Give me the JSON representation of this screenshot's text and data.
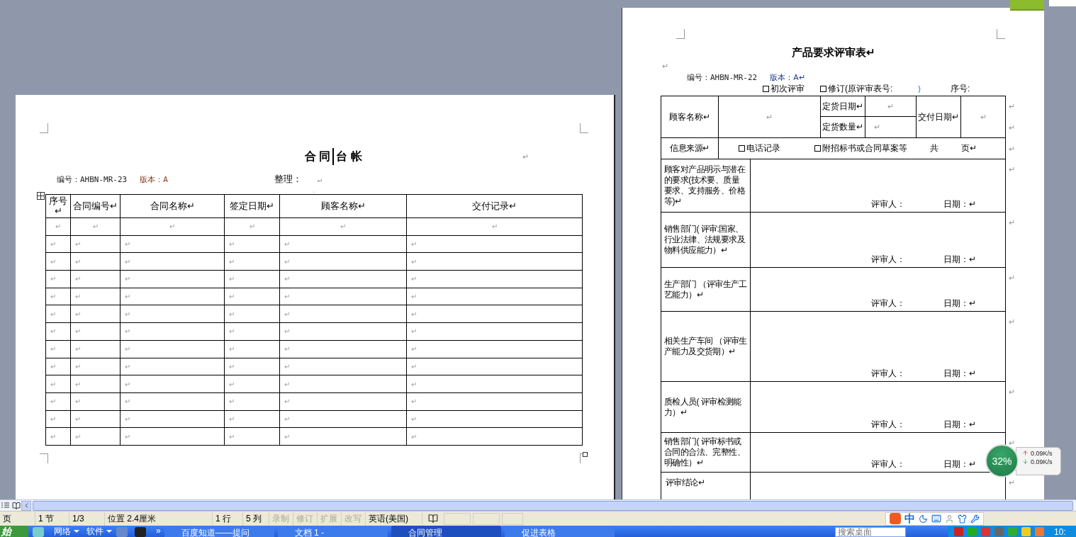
{
  "contract_ledger": {
    "title_parts": [
      "合 同",
      "台 帐"
    ],
    "title_mark": "↵",
    "code": "编号：AHBN-MR-23",
    "version": "版本：A",
    "organizer": "整理：",
    "organizer_mark": "↵",
    "top_mark": "˛",
    "table": {
      "columns": [
        "序号↵",
        "合同编号↵",
        "合同名称↵",
        "签定日期↵",
        "顾客名称↵",
        "交付记录↵"
      ],
      "rows": [
        [
          "↵",
          "↵",
          "↵",
          "↵",
          "↵",
          "↵"
        ],
        [
          "↵",
          "↵",
          "↵",
          "↵",
          "↵",
          "↵"
        ],
        [
          "↵",
          "↵",
          "↵",
          "↵",
          "↵",
          "↵"
        ],
        [
          "↵",
          "↵",
          "↵",
          "↵",
          "↵",
          "↵"
        ],
        [
          "↵",
          "↵",
          "↵",
          "↵",
          "↵",
          "↵"
        ],
        [
          "↵",
          "↵",
          "↵",
          "↵",
          "↵",
          "↵"
        ],
        [
          "↵",
          "↵",
          "↵",
          "↵",
          "↵",
          "↵"
        ],
        [
          "↵",
          "↵",
          "↵",
          "↵",
          "↵",
          "↵"
        ],
        [
          "↵",
          "↵",
          "↵",
          "↵",
          "↵",
          "↵"
        ],
        [
          "↵",
          "↵",
          "↵",
          "↵",
          "↵",
          "↵"
        ],
        [
          "↵",
          "↵",
          "↵",
          "↵",
          "↵",
          "↵"
        ],
        [
          "↵",
          "↵",
          "↵",
          "↵",
          "↵",
          "↵"
        ],
        [
          "↵",
          "↵",
          "↵",
          "↵",
          "↵",
          "↵"
        ]
      ]
    }
  },
  "review_form": {
    "title": "产品要求评审表↵",
    "blank_line": "↵",
    "code": "编号：AHBN-MR-22",
    "version": "版本：A↵",
    "review_types": [
      {
        "label": "初次评审",
        "checked": false
      },
      {
        "label": "修订(原评审表号:",
        "checked": false
      }
    ],
    "close_paren": ")",
    "serial": "序号:",
    "customer_label": "顾客名称↵",
    "customer_value": "↵",
    "order_date_label": "定货日期↵",
    "order_date_value": "↵",
    "order_qty_label": "定货数量↵",
    "order_qty_value": "↵",
    "delivery_label": "交付日期↵",
    "delivery_value": "↵",
    "header_marks": [
      "↵",
      "↵"
    ],
    "source_label": "信息来源↵",
    "sources": [
      {
        "label": "电话记录",
        "checked": false
      },
      {
        "label": "附招标书或合同草案等",
        "checked": false
      }
    ],
    "total": "共",
    "pages": "页↵",
    "source_mark": "↵",
    "reviews": [
      {
        "label": "顾客对产品明示与潜在的要求(技术要、质量要求、支持服务、价格等)↵",
        "reviewer": "评审人：",
        "date": "日期：↵",
        "mark": "↵"
      },
      {
        "label": "销售部门( 评审:国家、行业法律、法规要求及物料供应能力）↵",
        "reviewer": "评审人：",
        "date": "日期：↵",
        "mark": "↵"
      },
      {
        "label": "生产部门 （评审生产工艺能力）↵",
        "reviewer": "评审人：",
        "date": "日期：↵",
        "mark": "↵"
      },
      {
        "label": "相关生产车间 （评审生产能力及交货期）↵",
        "reviewer": "评审人：",
        "date": "日期：↵",
        "mark": "↵"
      },
      {
        "label": "质检人员( 评审检测能力）↵",
        "reviewer": "评审人：",
        "date": "日期：↵",
        "mark": "↵"
      },
      {
        "label": "销售部门( 评审标书或合同的合法、完整性、明确性）↵",
        "reviewer": "评审人：",
        "date": "日期：↵",
        "mark": "↵"
      }
    ],
    "conclusion": "评审结论↵",
    "conclusion_mark": "↵"
  },
  "speed_widget": {
    "percent": "32%",
    "upload": "0.09K/s",
    "download": "0.09K/s"
  },
  "status_bar": {
    "items": [
      {
        "text": "页",
        "disabled": false
      },
      {
        "text": "1 节",
        "disabled": false
      },
      {
        "text": "1/3",
        "disabled": false
      },
      {
        "text": "位置 2.4厘米",
        "disabled": false
      },
      {
        "text": "1 行",
        "disabled": false
      },
      {
        "text": "5 列",
        "disabled": false
      },
      {
        "text": "录制",
        "disabled": true
      },
      {
        "text": "修订",
        "disabled": true
      },
      {
        "text": "扩展",
        "disabled": true
      },
      {
        "text": "改写",
        "disabled": true
      },
      {
        "text": "英语(美国)",
        "disabled": false
      }
    ],
    "ime_label": "中"
  },
  "taskbar": {
    "start": "始",
    "toolbars": [
      "网络",
      "软件"
    ],
    "more": "»",
    "tasks": [
      {
        "label": "百度知道——提问",
        "selected": false
      },
      {
        "label": "文档 1 - ",
        "selected": false
      },
      {
        "label": "合同管理",
        "selected": true
      },
      {
        "label": "促进表格",
        "selected": false
      }
    ],
    "search_placeholder": "搜索桌面",
    "clock": "10:"
  }
}
